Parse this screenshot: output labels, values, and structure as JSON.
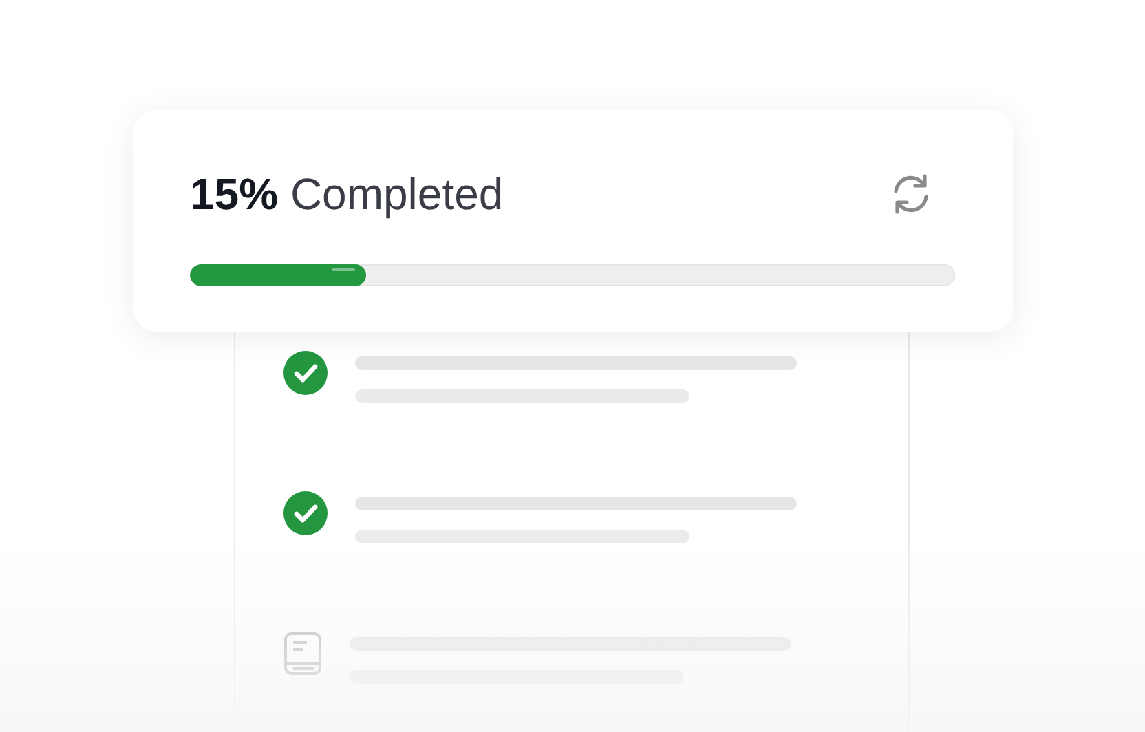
{
  "progress": {
    "percent": "15%",
    "label": "Completed"
  },
  "items": [
    {
      "kind": "lesson",
      "checked": true
    },
    {
      "kind": "lesson",
      "checked": true
    },
    {
      "kind": "lesson",
      "checked": false
    }
  ]
}
